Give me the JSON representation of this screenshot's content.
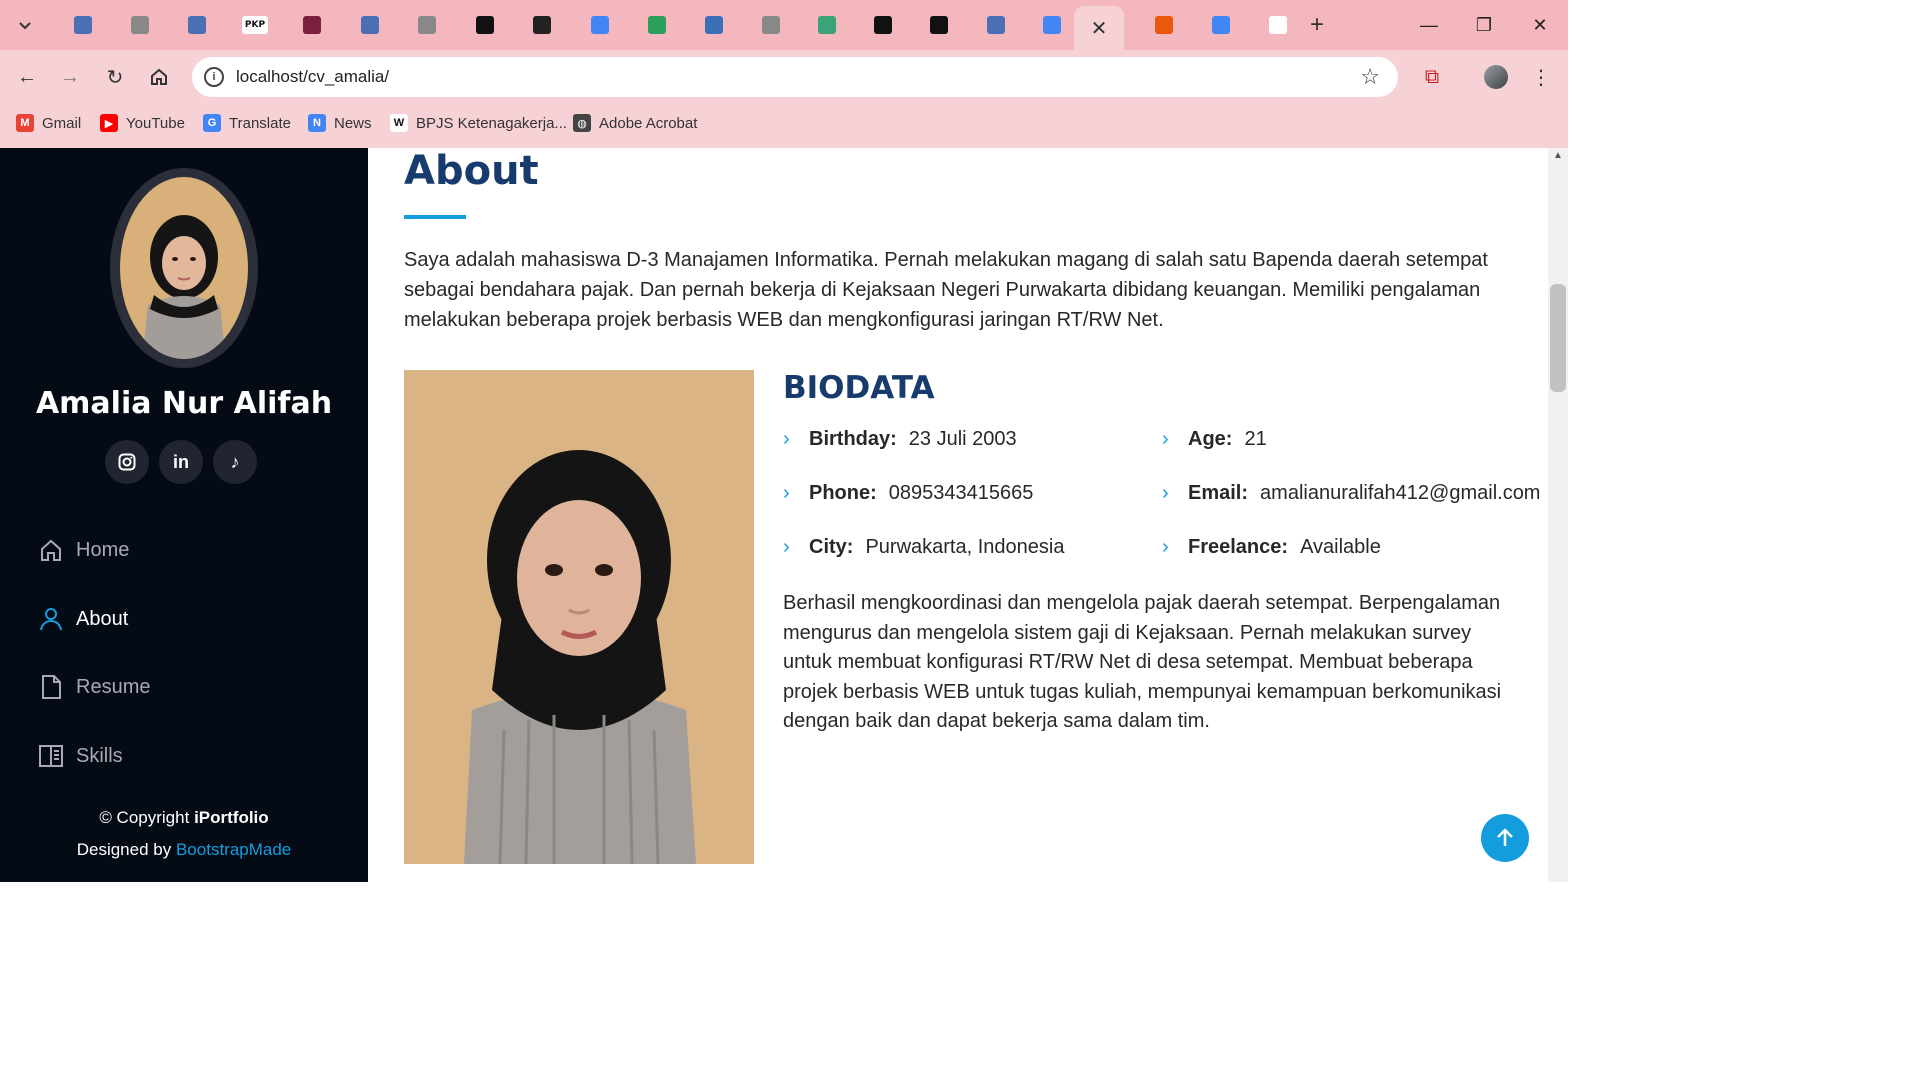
{
  "browser": {
    "tabs": [
      {
        "icon": "document-icon",
        "color": "#4a6fb5"
      },
      {
        "icon": "globe-icon",
        "color": "#888888"
      },
      {
        "icon": "document-icon",
        "color": "#4a6fb5"
      },
      {
        "icon": "pkp-icon",
        "label": "PKP",
        "color": "#ffffff"
      },
      {
        "icon": "university-logo-icon",
        "color": "#7a1f3d"
      },
      {
        "icon": "document-icon",
        "color": "#4a6fb5"
      },
      {
        "icon": "globe-icon",
        "color": "#888888"
      },
      {
        "icon": "puzzle-app-icon",
        "color": "#111111"
      },
      {
        "icon": "link-app-icon",
        "color": "#222222"
      },
      {
        "icon": "translate-icon",
        "color": "#4285f4"
      },
      {
        "icon": "robot-icon",
        "color": "#2e9e5b"
      },
      {
        "icon": "newspaper-icon",
        "color": "#3b6fb6"
      },
      {
        "icon": "globe-icon",
        "color": "#888888"
      },
      {
        "icon": "turtle-icon",
        "color": "#3aa37a"
      },
      {
        "icon": "openai-icon",
        "color": "#111111"
      },
      {
        "icon": "puzzle-app-icon",
        "color": "#111111"
      },
      {
        "icon": "document-icon",
        "color": "#4a6fb5"
      },
      {
        "icon": "google-icon",
        "color": "#4285f4"
      },
      {
        "icon": "fire-icon",
        "color": "#e8590c"
      },
      {
        "icon": "google-icon",
        "color": "#4285f4"
      },
      {
        "icon": "github-icon",
        "color": "#ffffff"
      }
    ],
    "url": "localhost/cv_amalia/",
    "bookmarks": [
      {
        "label": "Gmail",
        "icon": "gmail-icon",
        "color": "#ea4335",
        "glyph": "M"
      },
      {
        "label": "YouTube",
        "icon": "youtube-icon",
        "color": "#ff0000",
        "glyph": "▶"
      },
      {
        "label": "Translate",
        "icon": "translate-icon",
        "color": "#4285f4",
        "glyph": "G"
      },
      {
        "label": "News",
        "icon": "news-icon",
        "color": "#4285f4",
        "glyph": "N"
      },
      {
        "label": "BPJS Ketenagakerja...",
        "icon": "wikipedia-icon",
        "color": "#ffffff",
        "glyph": "W"
      },
      {
        "label": "Adobe Acrobat",
        "icon": "globe-icon",
        "color": "#444444",
        "glyph": "◍"
      }
    ]
  },
  "sidebar": {
    "name": "Amalia Nur Alifah",
    "social": [
      {
        "icon": "instagram-icon"
      },
      {
        "icon": "linkedin-icon",
        "glyph": "in"
      },
      {
        "icon": "tiktok-icon",
        "glyph": "♪"
      }
    ],
    "nav": [
      {
        "label": "Home",
        "icon": "home-icon",
        "active": false
      },
      {
        "label": "About",
        "icon": "person-icon",
        "active": true
      },
      {
        "label": "Resume",
        "icon": "file-icon",
        "active": false
      },
      {
        "label": "Skills",
        "icon": "book-icon",
        "active": false
      }
    ],
    "copyright_prefix": "© Copyright",
    "copyright_brand": "iPortfolio",
    "designed_by": "Designed by",
    "designer": "BootstrapMade"
  },
  "about": {
    "title": "About",
    "intro": "Saya adalah mahasiswa D-3 Manajamen Informatika. Pernah melakukan magang di salah satu Bapenda daerah setempat sebagai bendahara pajak. Dan pernah bekerja di Kejaksaan Negeri Purwakarta dibidang keuangan. Memiliki pengalaman melakukan beberapa projek berbasis WEB dan mengkonfigurasi jaringan RT/RW Net.",
    "biodata_title": "BIODATA",
    "biodata": {
      "birthday": {
        "label": "Birthday:",
        "value": "23 Juli 2003"
      },
      "age": {
        "label": "Age:",
        "value": "21"
      },
      "phone": {
        "label": "Phone:",
        "value": "0895343415665"
      },
      "email": {
        "label": "Email:",
        "value": "amalianuralifah412@gmail.com"
      },
      "city": {
        "label": "City:",
        "value": "Purwakarta, Indonesia"
      },
      "freelance": {
        "label": "Freelance:",
        "value": "Available"
      }
    },
    "description": "Berhasil mengkoordinasi dan mengelola pajak daerah setempat. Berpengalaman mengurus dan mengelola sistem gaji di Kejaksaan. Pernah melakukan survey untuk membuat konfigurasi RT/RW Net di desa setempat. Membuat beberapa projek berbasis WEB untuk tugas kuliah, mempunyai kemampuan berkomunikasi dengan baik dan dapat bekerja sama dalam tim."
  },
  "colors": {
    "accent": "#149ddd",
    "heading": "#173b6c",
    "sidebar_bg": "#040b14",
    "tabstrip_bg": "#f3b7bd",
    "toolbar_bg": "#f6d2d6"
  }
}
